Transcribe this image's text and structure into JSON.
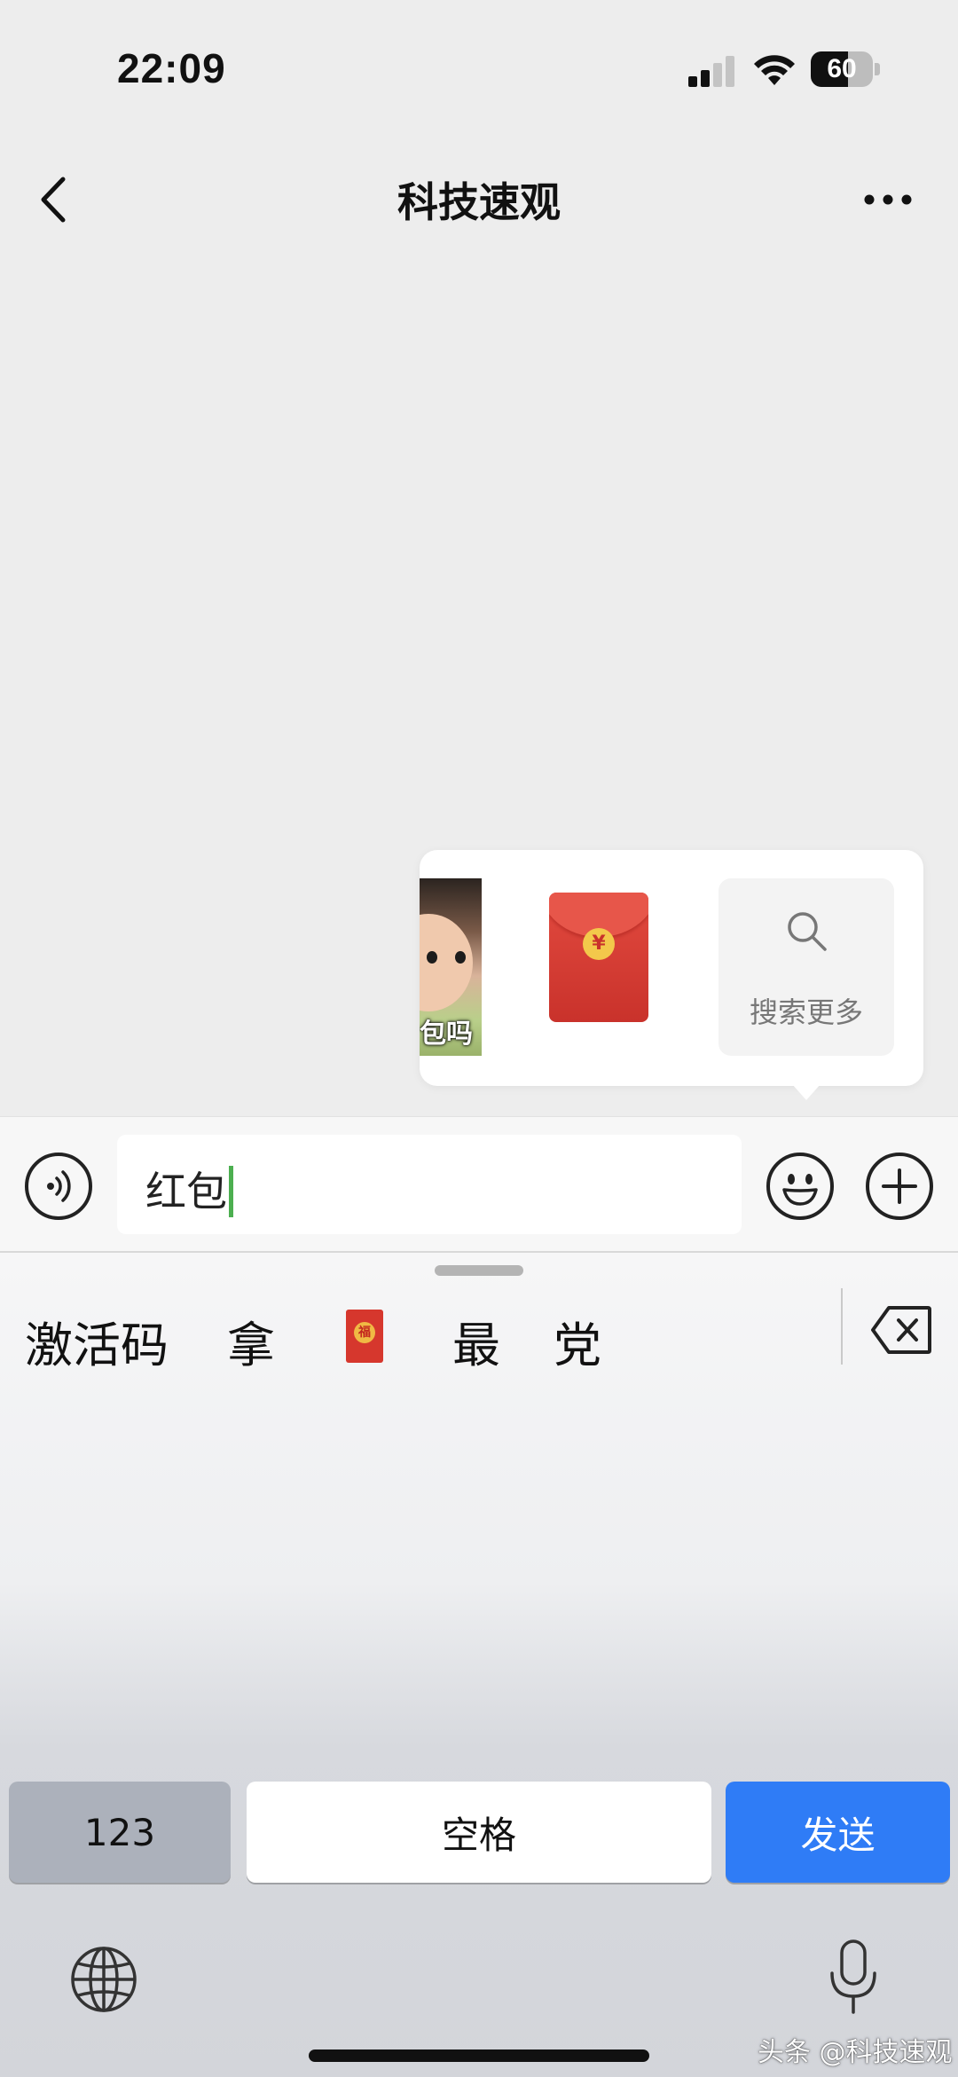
{
  "status_bar": {
    "time": "22:09",
    "battery_level": "60",
    "battery_fraction": 0.6,
    "signal_bars_active": 2,
    "signal_bars_total": 4
  },
  "nav": {
    "title": "科技速观",
    "back_icon": "chevron-left-icon",
    "more_icon": "ellipsis-icon"
  },
  "sticker_suggestions": {
    "items": [
      {
        "kind": "photo-sticker",
        "caption": "包吗"
      },
      {
        "kind": "red-envelope-sticker",
        "coin_symbol": "¥"
      }
    ],
    "search_more_label": "搜索更多"
  },
  "input_bar": {
    "text": "红包",
    "voice_icon": "voice-icon",
    "emoji_icon": "emoji-icon",
    "plus_icon": "plus-circle-icon"
  },
  "keyboard": {
    "candidates": [
      "激活码",
      "拿",
      "最",
      "党"
    ],
    "candidate_emoji": "red-envelope-emoji",
    "emoji_glyph": "福",
    "key_123": "123",
    "key_space": "空格",
    "key_send": "发送",
    "send_color": "#2f7cf6",
    "globe_icon": "globe-icon",
    "mic_icon": "microphone-icon",
    "delete_icon": "backspace-icon"
  },
  "watermark": "头条 @科技速观"
}
